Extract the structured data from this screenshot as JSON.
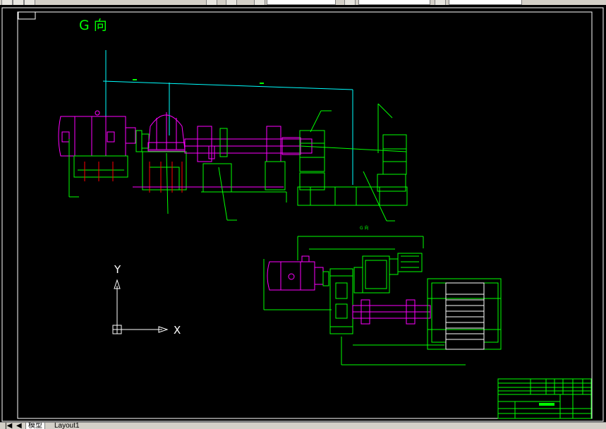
{
  "colors": {
    "green": "#00ff00",
    "magenta": "#ff00ff",
    "cyan": "#00ffff",
    "white": "#ffffff",
    "red": "#ff0000",
    "background": "#000000"
  },
  "drawing": {
    "view_label": "G 向",
    "sub_view_label": "G 向",
    "ucs": {
      "y_label": "Y",
      "x_label": "X"
    }
  },
  "tabs": [
    {
      "label": "模型",
      "active": true
    },
    {
      "label": "Layout1",
      "active": false
    }
  ],
  "icons": {
    "tab_first": "nav-first-icon",
    "tab_prev": "nav-prev-icon",
    "ucs": "ucs-icon"
  }
}
